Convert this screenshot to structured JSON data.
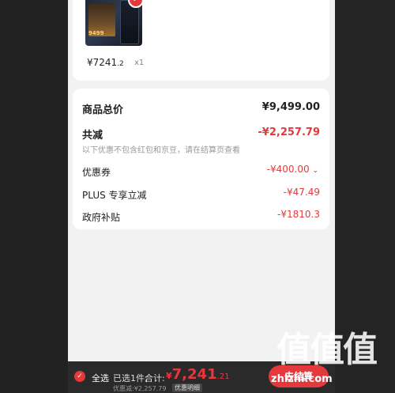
{
  "product": {
    "price_main": "¥7241",
    "price_decimal": ".2",
    "qty": "x1"
  },
  "summary": {
    "total_label": "商品总价",
    "total_value": "¥9,499.00",
    "reduce_label": "共减",
    "reduce_value": "-¥2,257.79",
    "reduce_note": "以下优惠不包含红包和京豆，请在结算页查看",
    "coupon_label": "优惠券",
    "coupon_value": "-¥400.00",
    "plus_label": "PLUS 专享立减",
    "plus_value": "-¥47.49",
    "gov_label": "政府补贴",
    "gov_value": "-¥1810.3"
  },
  "bottom_bar": {
    "select_all": "全选",
    "selected_count": "已选1件,",
    "total_label": "合计:",
    "total_currency": "¥",
    "total_int": "7,241",
    "total_dec": ".21",
    "discount_text": "优惠减:¥2,257.79",
    "detail_label": "优惠明细",
    "checkout_label": "去结算"
  },
  "watermark": {
    "brand_big": "值值值",
    "brand_url": "zhizhi.com"
  },
  "colors": {
    "accent": "#e4393c",
    "background": "#f2f2f2",
    "card": "#ffffff"
  }
}
